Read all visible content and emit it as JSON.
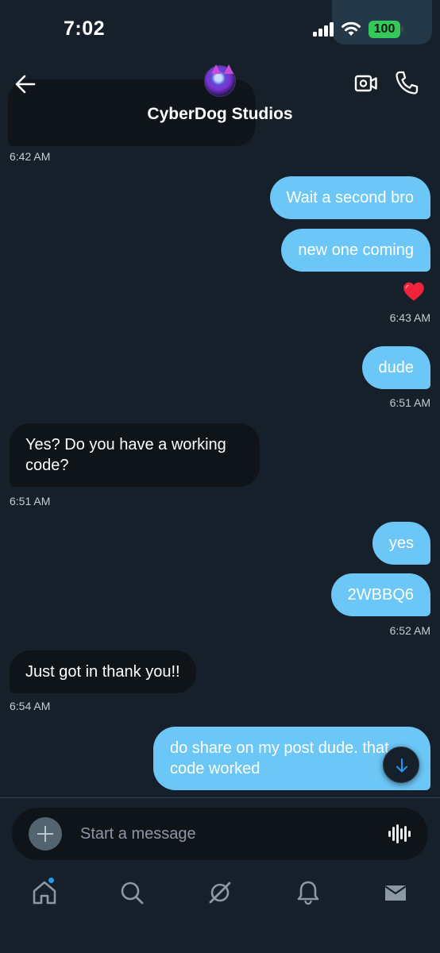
{
  "status_bar": {
    "time": "7:02",
    "battery": "100"
  },
  "header": {
    "contact_name": "CyberDog Studios"
  },
  "messages": [
    {
      "text": "Wait a second bro",
      "direction": "out"
    },
    {
      "text": "new one coming",
      "direction": "out",
      "reaction": "heart"
    },
    {
      "text": "dude",
      "direction": "out"
    },
    {
      "text": "Yes? Do you have a working code?",
      "direction": "in"
    },
    {
      "text": "yes",
      "direction": "out"
    },
    {
      "text": "2WBBQ6",
      "direction": "out"
    },
    {
      "text": "Just got in thank you!!",
      "direction": "in"
    },
    {
      "text": "do share on my post dude. that code worked",
      "direction": "out"
    }
  ],
  "timestamps": {
    "t1": "6:42 AM",
    "t2": "6:43 AM",
    "t3": "6:51 AM",
    "t4": "6:51 AM",
    "t5": "6:52 AM",
    "t6": "6:54 AM"
  },
  "composer": {
    "placeholder": "Start a message"
  },
  "nav": [
    "home-icon",
    "search-icon",
    "grok-icon",
    "notifications-icon",
    "messages-icon"
  ],
  "colors": {
    "background": "#15202b",
    "outgoing_bubble": "#6cc7f7",
    "incoming_bubble": "#0f1419",
    "accent": "#1d9bf0"
  }
}
